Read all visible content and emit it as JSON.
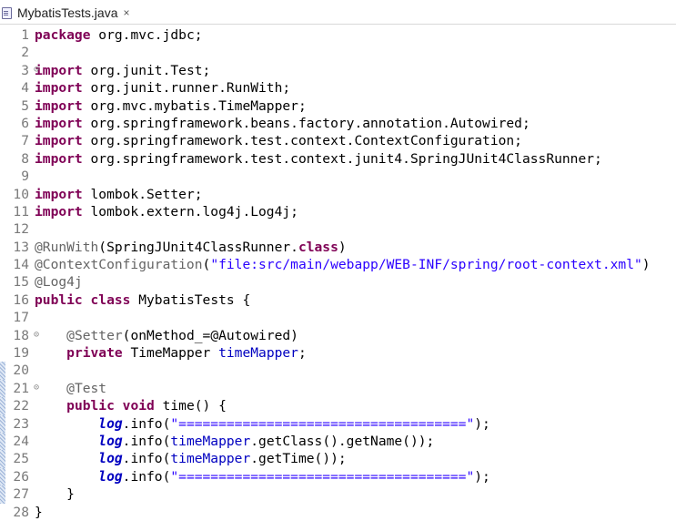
{
  "tab": {
    "title": "MybatisTests.java",
    "close": "×"
  },
  "lines": [
    [
      {
        "t": "package",
        "c": "kw"
      },
      {
        "t": " org.mvc.jdbc;"
      }
    ],
    [],
    [
      {
        "t": "import",
        "c": "kw"
      },
      {
        "t": " org.junit.Test;"
      }
    ],
    [
      {
        "t": "import",
        "c": "kw"
      },
      {
        "t": " org.junit.runner.RunWith;"
      }
    ],
    [
      {
        "t": "import",
        "c": "kw"
      },
      {
        "t": " org.mvc.mybatis.TimeMapper;"
      }
    ],
    [
      {
        "t": "import",
        "c": "kw"
      },
      {
        "t": " org.springframework.beans.factory.annotation.Autowired;"
      }
    ],
    [
      {
        "t": "import",
        "c": "kw"
      },
      {
        "t": " org.springframework.test.context.ContextConfiguration;"
      }
    ],
    [
      {
        "t": "import",
        "c": "kw"
      },
      {
        "t": " org.springframework.test.context.junit4.SpringJUnit4ClassRunner;"
      }
    ],
    [],
    [
      {
        "t": "import",
        "c": "kw"
      },
      {
        "t": " lombok.Setter;"
      }
    ],
    [
      {
        "t": "import",
        "c": "kw"
      },
      {
        "t": " lombok.extern.log4j.Log4j;"
      }
    ],
    [],
    [
      {
        "t": "@RunWith",
        "c": "ann"
      },
      {
        "t": "(SpringJUnit4ClassRunner."
      },
      {
        "t": "class",
        "c": "kw"
      },
      {
        "t": ")"
      }
    ],
    [
      {
        "t": "@ContextConfiguration",
        "c": "ann"
      },
      {
        "t": "("
      },
      {
        "t": "\"file:src/main/webapp/WEB-INF/spring/root-context.xml\"",
        "c": "str"
      },
      {
        "t": ")"
      }
    ],
    [
      {
        "t": "@Log4j",
        "c": "ann"
      }
    ],
    [
      {
        "t": "public",
        "c": "kw"
      },
      {
        "t": " "
      },
      {
        "t": "class",
        "c": "kw"
      },
      {
        "t": " MybatisTests {"
      }
    ],
    [],
    [
      {
        "t": "    "
      },
      {
        "t": "@Setter",
        "c": "ann"
      },
      {
        "t": "(onMethod_=@Autowired)"
      }
    ],
    [
      {
        "t": "    "
      },
      {
        "t": "private",
        "c": "kw"
      },
      {
        "t": " TimeMapper "
      },
      {
        "t": "timeMapper",
        "c": "fld"
      },
      {
        "t": ";"
      }
    ],
    [],
    [
      {
        "t": "    "
      },
      {
        "t": "@Test",
        "c": "ann"
      }
    ],
    [
      {
        "t": "    "
      },
      {
        "t": "public",
        "c": "kw"
      },
      {
        "t": " "
      },
      {
        "t": "void",
        "c": "kw"
      },
      {
        "t": " time() {"
      }
    ],
    [
      {
        "t": "        "
      },
      {
        "t": "log",
        "c": "log"
      },
      {
        "t": ".info("
      },
      {
        "t": "\"====================================\"",
        "c": "str"
      },
      {
        "t": ");"
      }
    ],
    [
      {
        "t": "        "
      },
      {
        "t": "log",
        "c": "log"
      },
      {
        "t": ".info("
      },
      {
        "t": "timeMapper",
        "c": "fld"
      },
      {
        "t": ".getClass().getName());"
      }
    ],
    [
      {
        "t": "        "
      },
      {
        "t": "log",
        "c": "log"
      },
      {
        "t": ".info("
      },
      {
        "t": "timeMapper",
        "c": "fld"
      },
      {
        "t": ".getTime());"
      }
    ],
    [
      {
        "t": "        "
      },
      {
        "t": "log",
        "c": "log"
      },
      {
        "t": ".info("
      },
      {
        "t": "\"====================================\"",
        "c": "str"
      },
      {
        "t": ");"
      }
    ],
    [
      {
        "t": "    }"
      }
    ],
    [
      {
        "t": "}"
      }
    ]
  ],
  "line_numbers": [
    "1",
    "2",
    "3",
    "4",
    "5",
    "6",
    "7",
    "8",
    "9",
    "10",
    "11",
    "12",
    "13",
    "14",
    "15",
    "16",
    "17",
    "18",
    "19",
    "20",
    "21",
    "22",
    "23",
    "24",
    "25",
    "26",
    "27",
    "28"
  ],
  "fold_lines": [
    3,
    18,
    21
  ],
  "changed_lines": [
    20,
    21,
    22,
    23,
    24,
    25,
    26,
    27
  ],
  "colors": {
    "keyword": "#7f0055",
    "annotation": "#646464",
    "string": "#2a00ff",
    "field": "#0000c0",
    "line_number": "#7a7a7a"
  }
}
